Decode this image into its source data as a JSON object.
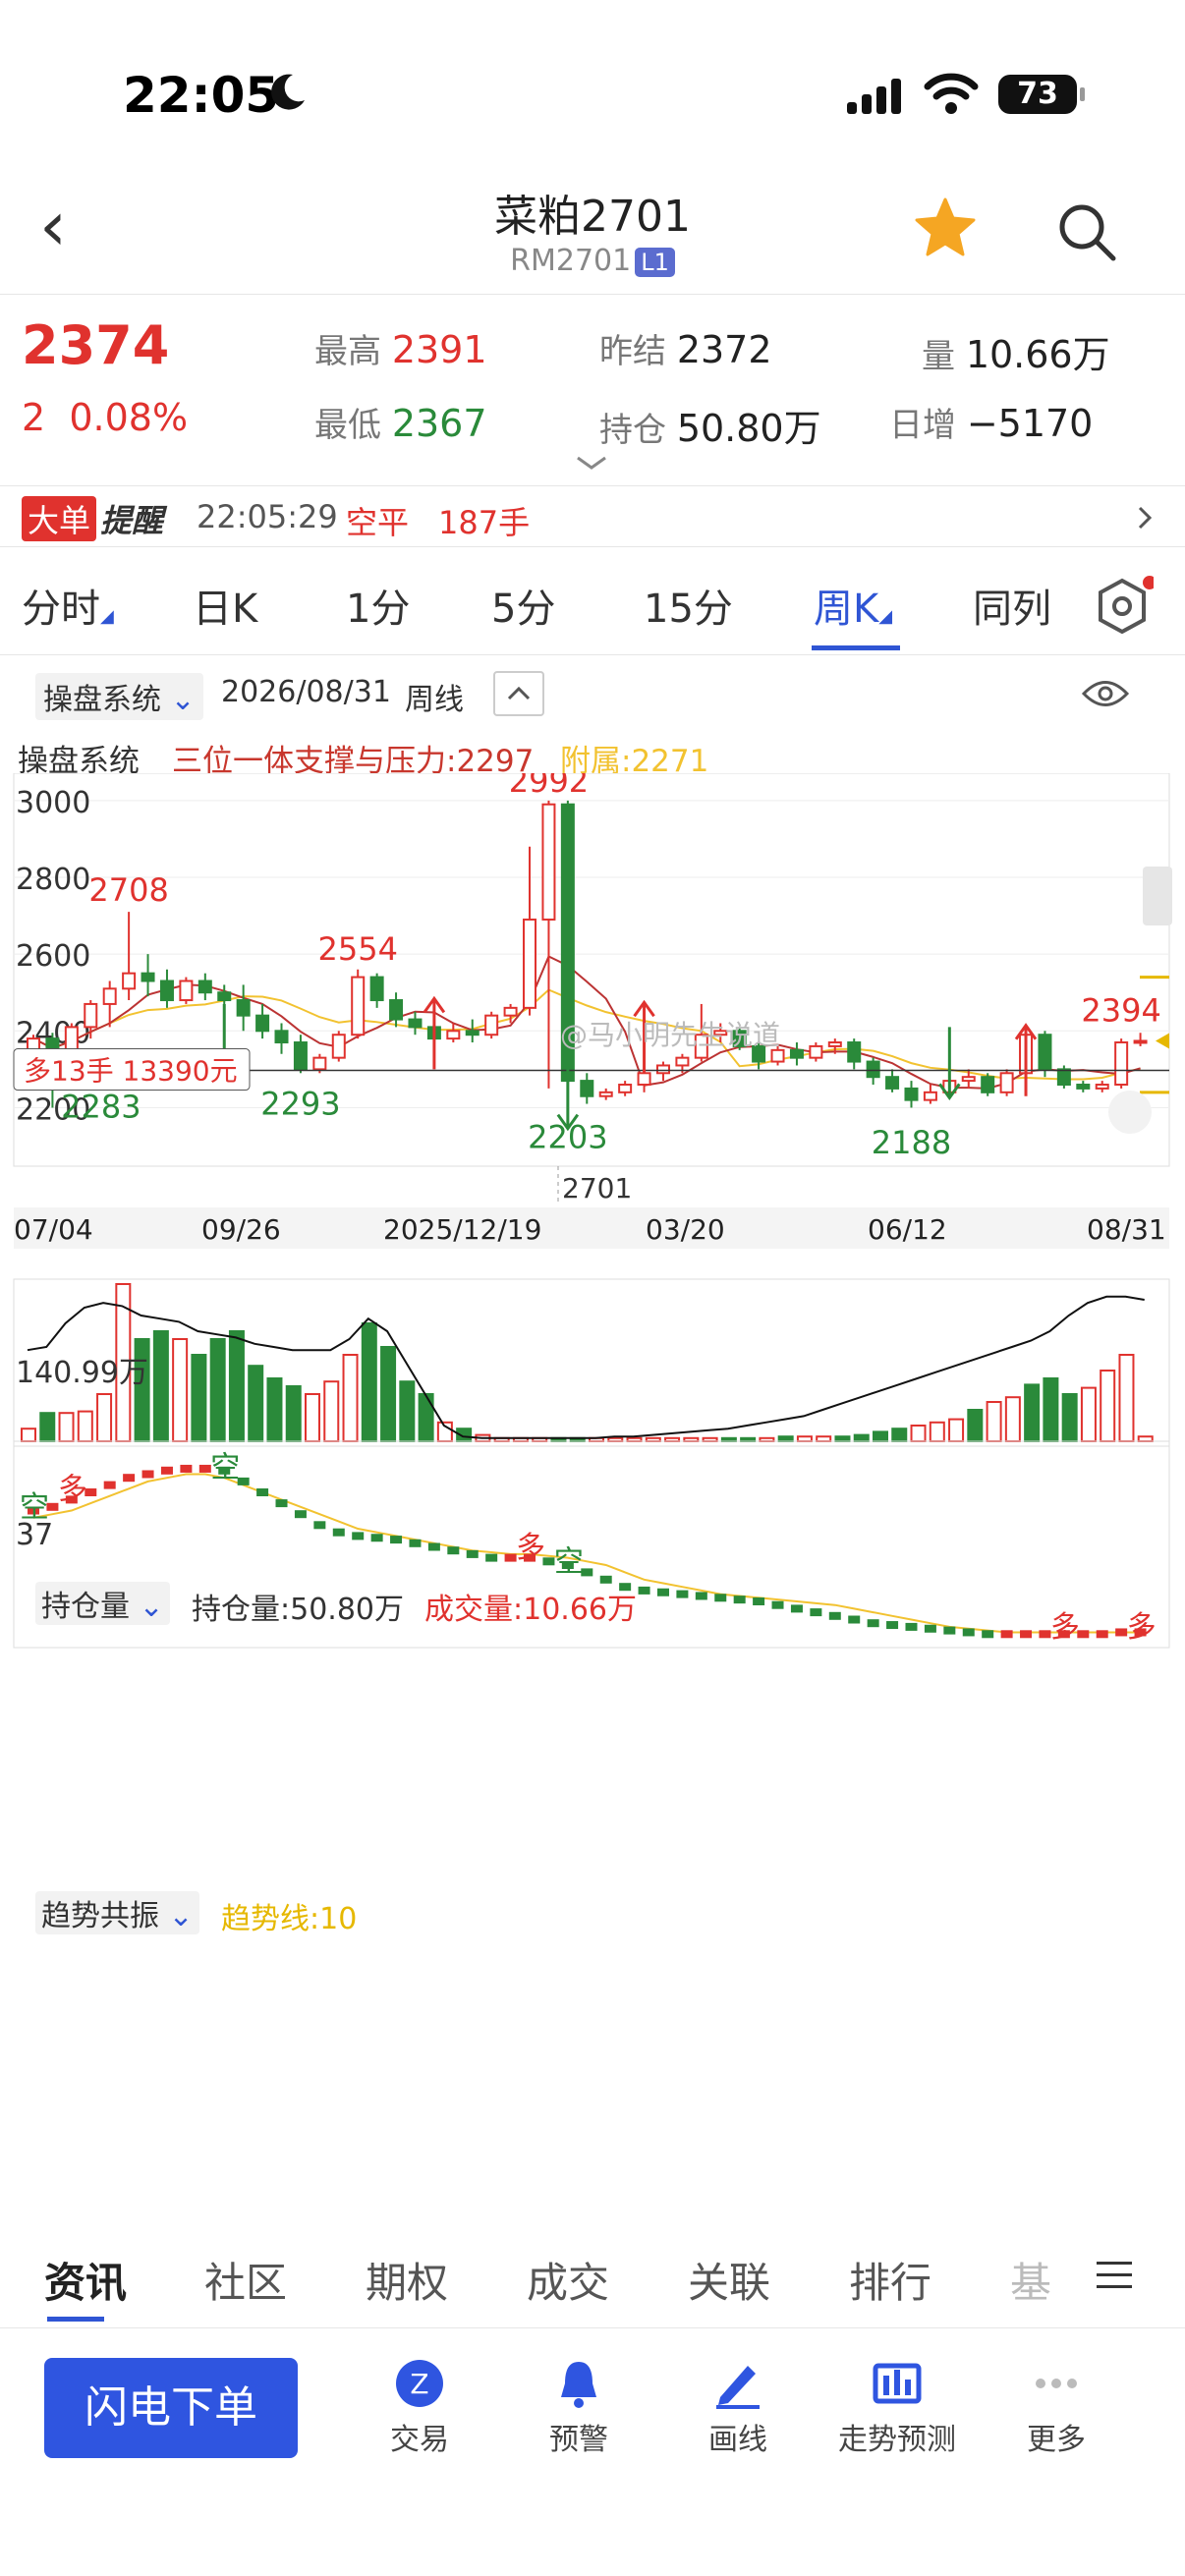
{
  "status": {
    "time": "22:05",
    "battery": "73"
  },
  "header": {
    "title": "菜粕2701",
    "code": "RM2701",
    "badge": "L1"
  },
  "quote": {
    "price": "2374",
    "change": "2",
    "change_pct": "0.08%",
    "high_label": "最高",
    "high": "2391",
    "low_label": "最低",
    "low": "2367",
    "prev_settle_label": "昨结",
    "prev_settle": "2372",
    "oi_label": "持仓",
    "oi": "50.80万",
    "vol_label": "量",
    "vol": "10.66万",
    "daily_inc_label": "日增",
    "daily_inc": "−5170"
  },
  "alert": {
    "tag1": "大单",
    "tag2": "提醒",
    "time": "22:05:29",
    "type": "空平",
    "qty": "187手"
  },
  "tabs": [
    "分时",
    "日K",
    "1分",
    "5分",
    "15分",
    "周K",
    "同列"
  ],
  "active_tab": "周K",
  "chart_toolbar": {
    "system": "操盘系统",
    "date": "2026/08/31",
    "period": "周线"
  },
  "indicator": {
    "name": "操盘系统",
    "support": "三位一体支撑与压力:2297",
    "aux": "附属:2271"
  },
  "kchart": {
    "y_ticks": [
      "3000",
      "2800",
      "2600",
      "2400",
      "2200"
    ],
    "peak_labels": [
      "2708",
      "2554",
      "2992",
      "2394"
    ],
    "trough_labels": [
      "2283",
      "2293",
      "2203",
      "2188"
    ],
    "position_label": "多13手 13390元",
    "contract_label": "2701",
    "watermark": "@马小明先生说道",
    "x_ticks": [
      "07/04",
      "09/26",
      "2025/12/19",
      "03/20",
      "06/12",
      "08/31"
    ]
  },
  "oi_panel": {
    "selector": "持仓量",
    "oi_text": "持仓量:50.80万",
    "vol_text": "成交量:10.66万",
    "y_label": "140.99万"
  },
  "trend_panel": {
    "selector": "趋势共振",
    "line_text": "趋势线:10",
    "y_label": "37",
    "marks": [
      "空",
      "多",
      "空",
      "多",
      "空",
      "多",
      "多"
    ]
  },
  "bottom_tabs": [
    "资讯",
    "社区",
    "期权",
    "成交",
    "关联",
    "排行",
    "基"
  ],
  "toolbar": {
    "order": "闪电下单",
    "items": [
      "交易",
      "预警",
      "画线",
      "走势预测",
      "更多"
    ]
  },
  "colors": {
    "up": "#e0322e",
    "down": "#2a8a3a",
    "accent": "#2f55d4",
    "ma": "#f2c230"
  },
  "chart_data": {
    "type": "candlestick",
    "x": [
      "07/04",
      "",
      "",
      "",
      "",
      "",
      "",
      "",
      "",
      "",
      "",
      "09/26",
      "",
      "",
      "",
      "",
      "",
      "",
      "",
      "",
      "",
      "",
      "",
      "2025/12/19",
      "",
      "",
      "",
      "",
      "",
      "",
      "",
      "",
      "",
      "",
      "",
      "03/20",
      "",
      "",
      "",
      "",
      "",
      "",
      "",
      "",
      "",
      "",
      "",
      "06/12",
      "",
      "",
      "",
      "",
      "",
      "",
      "",
      "",
      "",
      "",
      "08/31"
    ],
    "ylim": [
      2150,
      3020
    ],
    "candles_ohlc": [
      [
        2330,
        2390,
        2320,
        2380
      ],
      [
        2380,
        2395,
        2200,
        2330
      ],
      [
        2330,
        2420,
        2320,
        2410
      ],
      [
        2410,
        2480,
        2380,
        2470
      ],
      [
        2470,
        2530,
        2410,
        2510
      ],
      [
        2510,
        2710,
        2480,
        2550
      ],
      [
        2550,
        2600,
        2490,
        2530
      ],
      [
        2530,
        2560,
        2460,
        2480
      ],
      [
        2480,
        2540,
        2470,
        2530
      ],
      [
        2530,
        2550,
        2480,
        2500
      ],
      [
        2500,
        2520,
        2460,
        2480
      ],
      [
        2480,
        2520,
        2400,
        2440
      ],
      [
        2440,
        2470,
        2380,
        2400
      ],
      [
        2400,
        2420,
        2340,
        2370
      ],
      [
        2370,
        2390,
        2290,
        2300
      ],
      [
        2300,
        2340,
        2290,
        2330
      ],
      [
        2330,
        2400,
        2320,
        2390
      ],
      [
        2390,
        2560,
        2380,
        2540
      ],
      [
        2540,
        2550,
        2460,
        2480
      ],
      [
        2480,
        2500,
        2410,
        2430
      ],
      [
        2430,
        2450,
        2390,
        2410
      ],
      [
        2410,
        2430,
        2360,
        2380
      ],
      [
        2380,
        2420,
        2370,
        2400
      ],
      [
        2400,
        2430,
        2370,
        2390
      ],
      [
        2390,
        2450,
        2380,
        2440
      ],
      [
        2440,
        2470,
        2420,
        2460
      ],
      [
        2460,
        2880,
        2440,
        2690
      ],
      [
        2690,
        3000,
        2250,
        2990
      ],
      [
        2990,
        3000,
        2250,
        2270
      ],
      [
        2270,
        2290,
        2210,
        2230
      ],
      [
        2230,
        2250,
        2220,
        2240
      ],
      [
        2240,
        2270,
        2230,
        2260
      ],
      [
        2260,
        2300,
        2240,
        2290
      ],
      [
        2290,
        2320,
        2270,
        2310
      ],
      [
        2310,
        2340,
        2290,
        2330
      ],
      [
        2330,
        2470,
        2320,
        2390
      ],
      [
        2390,
        2420,
        2370,
        2400
      ],
      [
        2400,
        2410,
        2350,
        2360
      ],
      [
        2360,
        2370,
        2300,
        2320
      ],
      [
        2320,
        2360,
        2310,
        2350
      ],
      [
        2350,
        2370,
        2310,
        2330
      ],
      [
        2330,
        2370,
        2320,
        2360
      ],
      [
        2360,
        2380,
        2340,
        2370
      ],
      [
        2370,
        2380,
        2300,
        2320
      ],
      [
        2320,
        2330,
        2260,
        2280
      ],
      [
        2280,
        2300,
        2240,
        2250
      ],
      [
        2250,
        2270,
        2200,
        2220
      ],
      [
        2220,
        2260,
        2210,
        2240
      ],
      [
        2240,
        2280,
        2230,
        2270
      ],
      [
        2270,
        2300,
        2250,
        2280
      ],
      [
        2280,
        2290,
        2230,
        2240
      ],
      [
        2240,
        2300,
        2230,
        2290
      ],
      [
        2290,
        2400,
        2280,
        2390
      ],
      [
        2390,
        2400,
        2280,
        2300
      ],
      [
        2300,
        2310,
        2250,
        2260
      ],
      [
        2260,
        2270,
        2240,
        2250
      ],
      [
        2250,
        2270,
        2240,
        2260
      ],
      [
        2260,
        2380,
        2250,
        2370
      ],
      [
        2370,
        2395,
        2360,
        2374
      ]
    ],
    "oi_bars": [
      8,
      18,
      18,
      19,
      30,
      100,
      65,
      70,
      65,
      55,
      65,
      70,
      48,
      40,
      35,
      30,
      38,
      55,
      75,
      60,
      38,
      30,
      12,
      8,
      4,
      2,
      2,
      2,
      2,
      2,
      2,
      2,
      2,
      2,
      2,
      2,
      2,
      2,
      2,
      2,
      3,
      3,
      3,
      3,
      4,
      6,
      8,
      10,
      12,
      14,
      20,
      25,
      28,
      36,
      40,
      30,
      34,
      45,
      55,
      3
    ],
    "oi_line": [
      58,
      60,
      75,
      85,
      88,
      86,
      80,
      78,
      76,
      70,
      68,
      66,
      62,
      60,
      58,
      58,
      58,
      65,
      78,
      70,
      50,
      30,
      10,
      3,
      2,
      2,
      2,
      2,
      2,
      2,
      2,
      3,
      3,
      4,
      5,
      6,
      7,
      8,
      10,
      12,
      14,
      16,
      20,
      24,
      28,
      32,
      36,
      40,
      44,
      48,
      52,
      56,
      60,
      64,
      70,
      80,
      88,
      92,
      92,
      90
    ]
  }
}
